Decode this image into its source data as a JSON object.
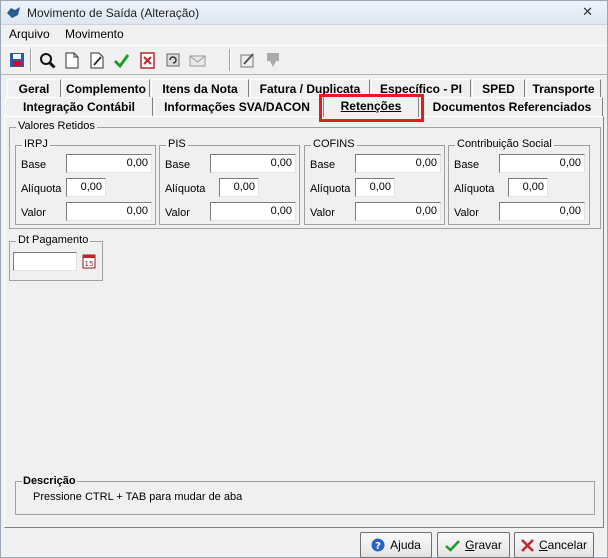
{
  "window": {
    "title": "Movimento de Saída (Alteração)",
    "close_glyph": "✕"
  },
  "menu": [
    "Arquivo",
    "Movimento"
  ],
  "toolbar_icons": [
    "save-icon",
    "search-icon",
    "new-document-icon",
    "edit-icon",
    "confirm-icon",
    "delete-icon",
    "refresh-icon",
    "mail-icon",
    "iss-icon",
    "stamp-icon"
  ],
  "tabs": {
    "row1": [
      "Geral",
      "Complemento",
      "Itens da Nota",
      "Fatura / Duplicata",
      "Específico - PI",
      "SPED",
      "Transporte"
    ],
    "row2": [
      "Integração Contábil",
      "Informações SVA/DACON",
      "Retenções",
      "Documentos Referenciados"
    ],
    "active": "Retenções"
  },
  "valores": {
    "title": "Valores Retidos",
    "irpj": {
      "title": "IRPJ",
      "base_label": "Base",
      "base": "0,00",
      "aliq_label": "Alíquota",
      "aliq": "0,00",
      "valor_label": "Valor",
      "valor": "0,00"
    },
    "pis": {
      "title": "PIS",
      "base_label": "Base",
      "base": "0,00",
      "aliq_label": "Alíquota",
      "aliq": "0,00",
      "valor_label": "Valor",
      "valor": "0,00"
    },
    "cofins": {
      "title": "COFINS",
      "base_label": "Base",
      "base": "0,00",
      "aliq_label": "Alíquota",
      "aliq": "0,00",
      "valor_label": "Valor",
      "valor": "0,00"
    },
    "csll": {
      "title": "Contribuição Social",
      "base_label": "Base",
      "base": "0,00",
      "aliq_label": "Alíquota",
      "aliq": "0,00",
      "valor_label": "Valor",
      "valor": "0,00"
    }
  },
  "dt_pagamento": {
    "title": "Dt Pagamento",
    "value": ""
  },
  "descricao": {
    "title": "Descrição",
    "text": "Pressione CTRL + TAB para  mudar de aba"
  },
  "buttons": {
    "ajuda": {
      "pre": "A",
      "u": "j",
      "post": "uda"
    },
    "gravar": {
      "pre": "",
      "u": "G",
      "post": "ravar"
    },
    "cancelar": {
      "pre": "",
      "u": "C",
      "post": "ancelar"
    }
  },
  "colors": {
    "highlight": "#e31b23",
    "confirm_green": "#1f9a2a",
    "delete_red": "#c0262c"
  }
}
